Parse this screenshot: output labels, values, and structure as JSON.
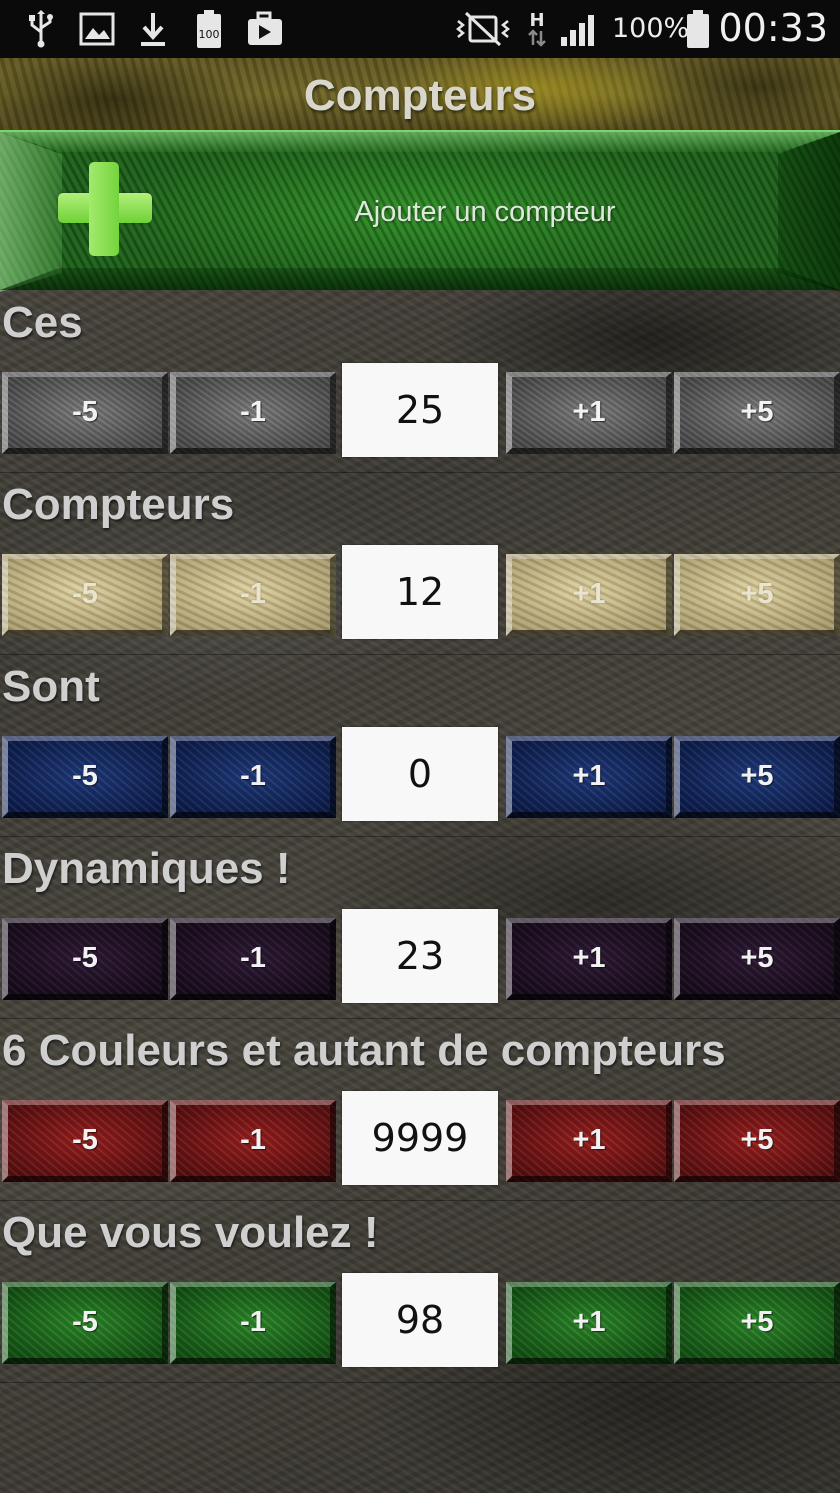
{
  "status_bar": {
    "battery_percent": "100%",
    "time": "00:33",
    "icons": [
      "usb-icon",
      "image-icon",
      "download-icon",
      "battery-100-notification-icon",
      "briefcase-icon",
      "vibrate-off-icon",
      "hspa-signal-icon",
      "cell-signal-icon",
      "battery-icon"
    ]
  },
  "header": {
    "title": "Compteurs"
  },
  "add_button": {
    "label": "Ajouter un compteur",
    "icon": "plus-icon"
  },
  "counters": [
    {
      "title": "Ces",
      "value": "25",
      "color": "#5a5a5a",
      "buttons": [
        "-5",
        "-1",
        "+1",
        "+5"
      ]
    },
    {
      "title": "Compteurs",
      "value": "12",
      "color": "#c9bb8a",
      "buttons": [
        "-5",
        "-1",
        "+1",
        "+5"
      ]
    },
    {
      "title": "Sont",
      "value": "0",
      "color": "#132a63",
      "buttons": [
        "-5",
        "-1",
        "+1",
        "+5"
      ]
    },
    {
      "title": "Dynamiques !",
      "value": "23",
      "color": "#22122a",
      "buttons": [
        "-5",
        "-1",
        "+1",
        "+5"
      ]
    },
    {
      "title": "6 Couleurs et autant de compteurs",
      "value": "9999",
      "color": "#7a1616",
      "buttons": [
        "-5",
        "-1",
        "+1",
        "+5"
      ]
    },
    {
      "title": "Que vous voulez !",
      "value": "98",
      "color": "#1f6d1e",
      "buttons": [
        "-5",
        "-1",
        "+1",
        "+5"
      ]
    }
  ]
}
